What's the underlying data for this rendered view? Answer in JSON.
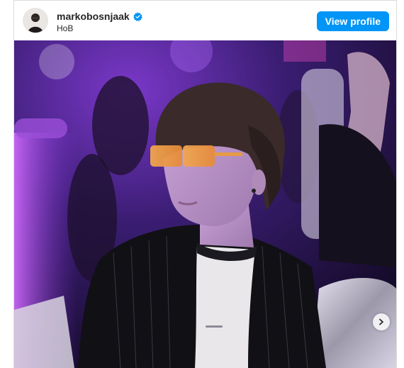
{
  "post": {
    "username": "markobosnjaak",
    "location": "HoB",
    "verified": true,
    "view_profile_label": "View profile"
  },
  "photo": {
    "description_icon": "photo-of-person-with-orange-sunglasses-at-party"
  },
  "controls": {
    "next_icon": "chevron-right-icon"
  },
  "colors": {
    "button_blue": "#0095f6",
    "verified_blue": "#0095f6",
    "text_dark": "#262626",
    "border": "#dbdbdb"
  }
}
